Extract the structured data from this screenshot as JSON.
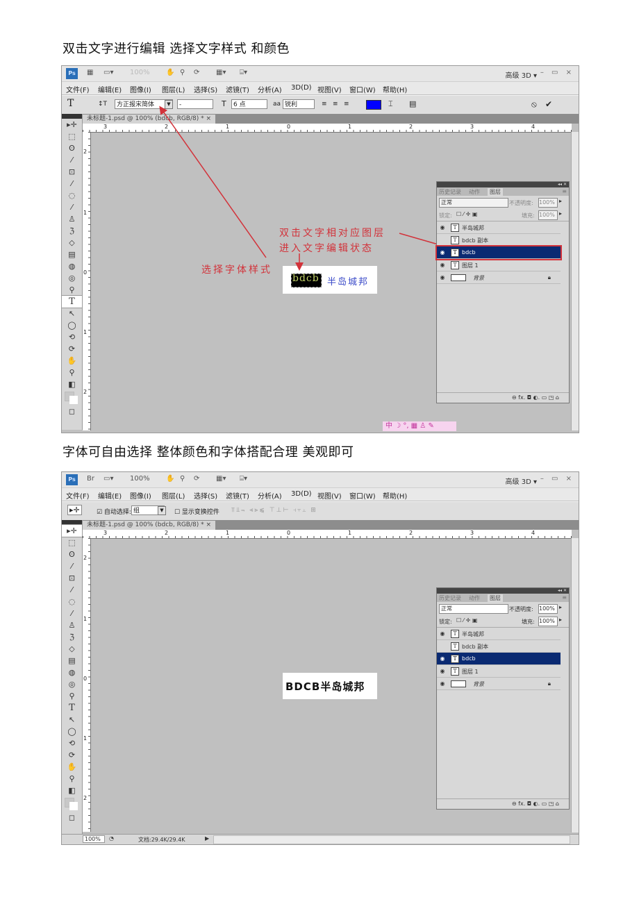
{
  "captions": {
    "top": "双击文字进行编辑  选择文字样式  和颜色",
    "middle": "字体可自由选择  整体颜色和字体搭配合理    美观即可"
  },
  "app": {
    "logo": "Ps",
    "bridge": "Br",
    "zoom_display": "100%",
    "workspace": "高级 3D ▾",
    "window_controls": "– ▭ ×",
    "menu": [
      "文件(F)",
      "编辑(E)",
      "图像(I)",
      "图层(L)",
      "选择(S)",
      "滤镜(T)",
      "分析(A)",
      "3D(D)",
      "视图(V)",
      "窗口(W)",
      "帮助(H)"
    ],
    "doc_tab": "未标题-1.psd @ 100% (bdcb, RGB/8) * ×",
    "ruler_h_labels": [
      "3",
      "2",
      "1",
      "0",
      "1",
      "2",
      "3",
      "4"
    ],
    "ruler_v_labels": [
      "2",
      "1",
      "0",
      "1",
      "2"
    ]
  },
  "shot1": {
    "options": {
      "tool": "T",
      "font_family": "方正报宋简体",
      "font_style": "-",
      "font_size": "6 点",
      "antialias_icon": "aa",
      "antialias": "锐利",
      "color": "#0000ff",
      "cancel_icon": "⦸",
      "commit_icon": "✔"
    },
    "layers_panel": {
      "tabs": [
        "历史记录",
        "动作",
        "图层"
      ],
      "blend_mode": "正常",
      "opacity_label": "不透明度:",
      "opacity": "100%",
      "lock_label": "锁定:",
      "fill_label": "填充:",
      "fill": "100%",
      "layers": [
        {
          "name": "半岛城邦",
          "visible": true,
          "type": "T",
          "selected": false
        },
        {
          "name": "bdcb 副本",
          "visible": false,
          "type": "T",
          "selected": false
        },
        {
          "name": "bdcb",
          "visible": true,
          "type": "T",
          "selected": true
        },
        {
          "name": "图层 1",
          "visible": true,
          "type": "T",
          "selected": false
        },
        {
          "name": "背景",
          "visible": true,
          "type": "bg",
          "selected": false
        }
      ],
      "footer_icons": "⊖ fx. ◘ ◐. ▭ ◳ ⌂"
    },
    "canvas": {
      "logo_latin": "bdcb",
      "logo_cn": "半岛城邦"
    },
    "annotations": {
      "font_style": "选择字体样式",
      "layer_line1": "双击文字相对应图层",
      "layer_line2": "进入文字编辑状态"
    },
    "ime_bar": "中 ☽ °, ▦ ♙ ✎"
  },
  "shot2": {
    "options": {
      "tool": "▸✛",
      "auto_select_label": "☑ 自动选择:",
      "auto_select_value": "组",
      "show_transform": "☐ 显示变换控件",
      "align_icons": "⫪⫫⫬  ⫷⫸⫹  ⊤⊥⊢  ⫞⫟⫠  ⊞"
    },
    "layers_panel": {
      "tabs": [
        "历史记录",
        "动作",
        "图层"
      ],
      "blend_mode": "正常",
      "opacity_label": "不透明度:",
      "opacity": "100%",
      "lock_label": "锁定:",
      "fill_label": "填充:",
      "fill": "100%",
      "layers": [
        {
          "name": "半岛城邦",
          "visible": true,
          "type": "T",
          "selected": false
        },
        {
          "name": "bdcb 副本",
          "visible": false,
          "type": "T",
          "selected": false
        },
        {
          "name": "bdcb",
          "visible": true,
          "type": "T",
          "selected": true
        },
        {
          "name": "图层 1",
          "visible": true,
          "type": "T",
          "selected": false
        },
        {
          "name": "背景",
          "visible": true,
          "type": "bg",
          "selected": false
        }
      ],
      "footer_icons": "⊖ fx. ◘ ◐. ▭ ◳ ⌂"
    },
    "canvas": {
      "logo_text": "BDCB半岛城邦"
    },
    "status": {
      "zoom": "100%",
      "doc_info": "文档:29.4K/29.4K"
    }
  },
  "tools": [
    "▸✛",
    "⬚",
    "ʘ",
    "⁄",
    "⊡",
    "⁄",
    "◌",
    "⁄",
    "♙",
    "ℨ",
    "◇",
    "▤",
    "◍",
    "◎",
    "⚲",
    "T",
    "↖",
    "◯",
    "⟲",
    "⟳",
    "✋",
    "⚲",
    "◧",
    "▢",
    "◻"
  ]
}
